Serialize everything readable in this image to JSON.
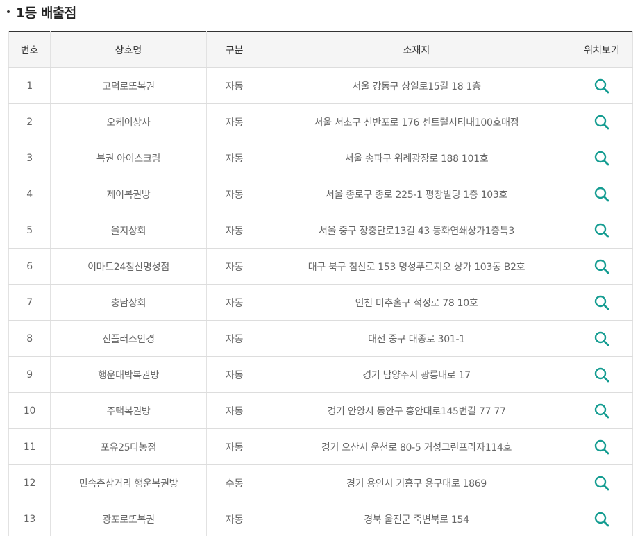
{
  "section": {
    "title": "1등 배출점"
  },
  "table": {
    "headers": {
      "no": "번호",
      "name": "상호명",
      "type": "구분",
      "address": "소재지",
      "map": "위치보기"
    },
    "rows": [
      {
        "no": "1",
        "name": "고덕로또복권",
        "type": "자동",
        "address": "서울 강동구 상일로15길 18 1층"
      },
      {
        "no": "2",
        "name": "오케이상사",
        "type": "자동",
        "address": "서울 서초구 신반포로 176 센트럴시티내100호매점"
      },
      {
        "no": "3",
        "name": "복권 아이스크림",
        "type": "자동",
        "address": "서울 송파구 위례광장로 188 101호"
      },
      {
        "no": "4",
        "name": "제이복권방",
        "type": "자동",
        "address": "서울 종로구 종로 225-1 평창빌딩 1층 103호"
      },
      {
        "no": "5",
        "name": "을지상회",
        "type": "자동",
        "address": "서울 중구 장충단로13길 43 동화연쇄상가1층특3"
      },
      {
        "no": "6",
        "name": "이마트24침산명성점",
        "type": "자동",
        "address": "대구 북구 침산로 153 명성푸르지오 상가 103동 B2호"
      },
      {
        "no": "7",
        "name": "충남상회",
        "type": "자동",
        "address": "인천 미추홀구 석정로 78 10호"
      },
      {
        "no": "8",
        "name": "진플러스안경",
        "type": "자동",
        "address": "대전 중구 대종로 301-1"
      },
      {
        "no": "9",
        "name": "행운대박복권방",
        "type": "자동",
        "address": "경기 남양주시 광릉내로 17"
      },
      {
        "no": "10",
        "name": "주택복권방",
        "type": "자동",
        "address": "경기 안양시 동안구 흥안대로145번길 77 77"
      },
      {
        "no": "11",
        "name": "포유25다농점",
        "type": "자동",
        "address": "경기 오산시 운천로 80-5 거성그린프라자114호"
      },
      {
        "no": "12",
        "name": "민속촌삼거리 행운복권방",
        "type": "수동",
        "address": "경기 용인시 기흥구 용구대로 1869"
      },
      {
        "no": "13",
        "name": "광포로또복권",
        "type": "자동",
        "address": "경북 울진군 죽변북로 154"
      }
    ]
  },
  "icons": {
    "location": "search-icon",
    "accent_color": "#149c91"
  }
}
